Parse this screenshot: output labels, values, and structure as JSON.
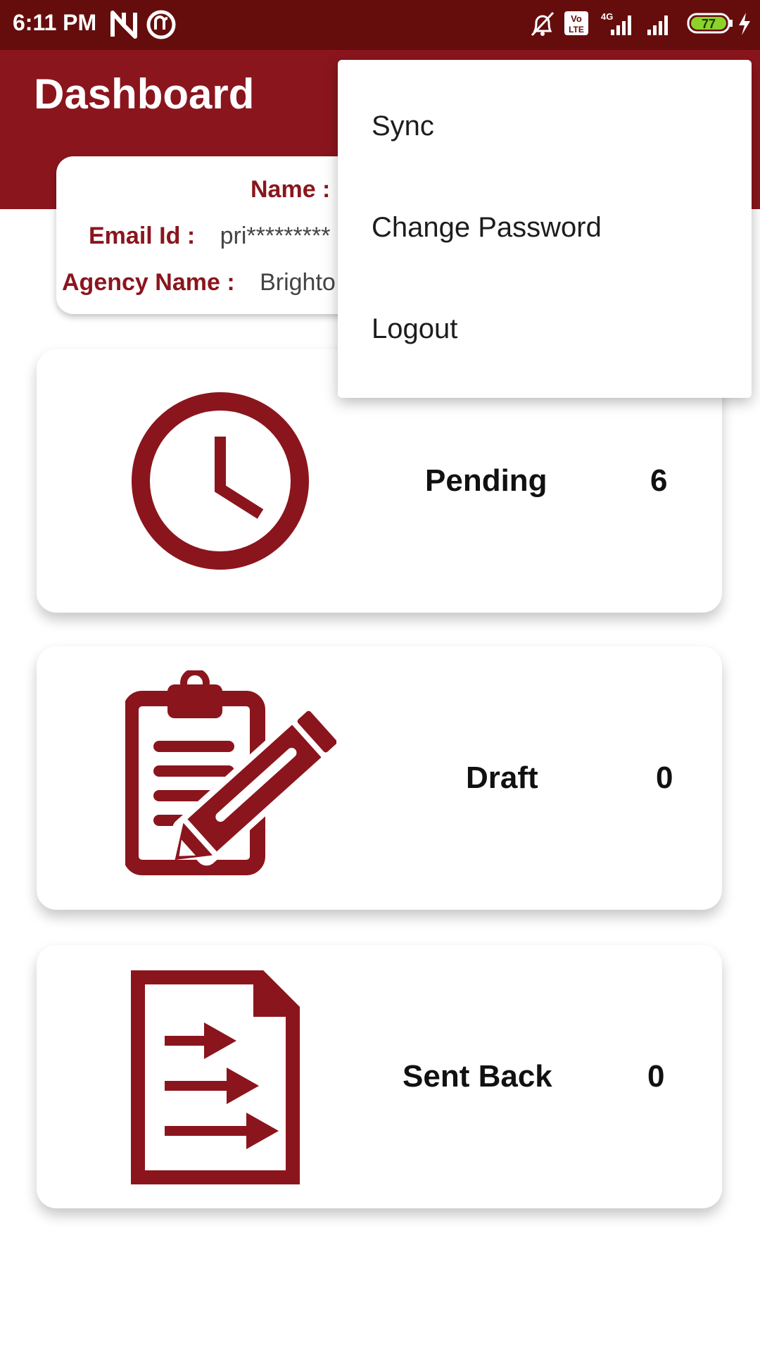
{
  "status_bar": {
    "time": "6:11 PM",
    "battery_level": "77",
    "icons": [
      "n-app-icon",
      "sync-app-icon",
      "bell-muted-icon",
      "volte-icon",
      "4g-signal-icon",
      "signal-icon",
      "battery-icon",
      "charging-icon"
    ],
    "network_label": "4G",
    "volte_top": "Vo",
    "volte_bottom": "LTE"
  },
  "app_bar": {
    "title": "Dashboard"
  },
  "profile": {
    "name_label": "Name :",
    "name_value": "",
    "email_label": "Email Id :",
    "email_value": "pri*********",
    "agency_label": "Agency Name :",
    "agency_value": "Brighto C"
  },
  "stats": [
    {
      "label": "Pending",
      "count": "6",
      "icon": "clock-icon"
    },
    {
      "label": "Draft",
      "count": "0",
      "icon": "clipboard-pencil-icon"
    },
    {
      "label": "Sent Back",
      "count": "0",
      "icon": "document-arrows-icon"
    }
  ],
  "menu": {
    "items": [
      "Sync",
      "Change Password",
      "Logout"
    ]
  },
  "colors": {
    "primary": "#8b151d",
    "status_bar": "#650d0d",
    "battery": "#8bd32a"
  }
}
